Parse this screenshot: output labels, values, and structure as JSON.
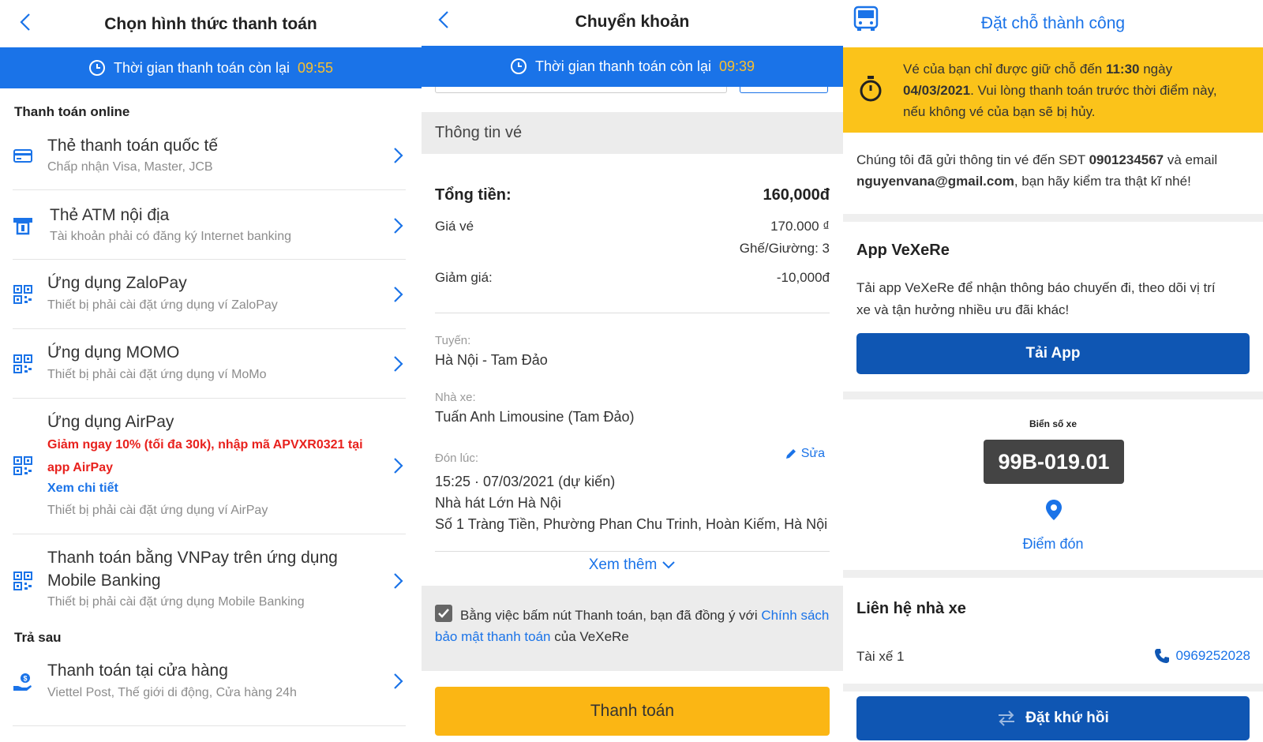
{
  "screen1": {
    "title": "Chọn hình thức thanh toán",
    "timer_label": "Thời gian thanh toán còn lại",
    "timer_value": "09:55",
    "online_heading": "Thanh toán online",
    "methods": [
      {
        "name": "Thẻ thanh toán quốc tế",
        "sub": "Chấp nhận Visa, Master, JCB",
        "icon": "credit-card-icon"
      },
      {
        "name": "Thẻ ATM nội địa",
        "sub": "Tài khoản phải có đăng ký Internet banking",
        "icon": "atm-icon"
      },
      {
        "name": "Ứng dụng ZaloPay",
        "sub": "Thiết bị phải cài đặt ứng dụng ví ZaloPay",
        "icon": "qr-icon"
      },
      {
        "name": "Ứng dụng MOMO",
        "sub": "Thiết bị phải cài đặt ứng dụng ví MoMo",
        "icon": "qr-icon"
      },
      {
        "name": "Ứng dụng AirPay",
        "promo": "Giảm ngay 10% (tối đa 30k), nhập mã APVXR0321 tại app AirPay",
        "detail": "Xem chi tiết",
        "sub": "Thiết bị phải cài đặt ứng dụng ví AirPay",
        "icon": "qr-icon"
      },
      {
        "name_line1": "Thanh toán bằng VNPay trên ứng dụng",
        "name_line2": "Mobile Banking",
        "sub": "Thiết bị phải cài đặt ứng dụng Mobile Banking",
        "icon": "qr-icon"
      }
    ],
    "later_heading": "Trả sau",
    "store": {
      "name": "Thanh toán tại cửa hàng",
      "sub": "Viettel Post, Thế giới di động, Cửa hàng 24h",
      "icon": "hand-coin-icon"
    }
  },
  "screen2": {
    "title": "Chuyển khoản",
    "timer_label": "Thời gian thanh toán còn lại",
    "timer_value": "09:39",
    "ticket_header": "Thông tin vé",
    "total_label": "Tổng tiền:",
    "total_value": "160,000đ",
    "price_label": "Giá vé",
    "price_value": "170.000 ₫",
    "seat_value": "Ghế/Giường: 3",
    "discount_label": "Giảm giá:",
    "discount_value": "-10,000đ",
    "route_label": "Tuyến:",
    "route_value": "Hà Nội - Tam Đảo",
    "operator_label": "Nhà xe:",
    "operator_value": "Tuấn Anh Limousine (Tam Đảo)",
    "pickup_label": "Đón lúc:",
    "edit_label": "Sửa",
    "pickup_time": "15:25 · 07/03/2021 (dự kiến)",
    "pickup_place": "Nhà hát Lớn Hà Nội",
    "pickup_address": "Số 1 Tràng Tiền, Phường Phan Chu Trinh, Hoàn Kiếm, Hà Nội",
    "more_label": "Xem thêm",
    "agree_text": "Bằng việc bấm nút Thanh toán, bạn đã đồng ý với ",
    "agree_link_1": "Chính",
    "agree_link_2": "sách bảo mật thanh toán",
    "agree_suffix": " của VeXeRe",
    "pay_button": "Thanh toán"
  },
  "screen3": {
    "title": "Đặt chỗ thành công",
    "warn_p1": "Vé của bạn chỉ được giữ chỗ đến ",
    "warn_time": "11:30",
    "warn_p2": " ngày",
    "warn_date": "04/03/2021",
    "warn_p3": ". Vui lòng thanh toán trước thời điểm này,",
    "warn_p4": "nếu không vé của bạn sẽ bị hủy.",
    "sent_p1": "Chúng tôi đã gửi thông tin vé đến SĐT ",
    "phone": "0901234567",
    "sent_p2": " và email",
    "email": "nguyenvana@gmail.com",
    "sent_p3": ", bạn hãy kiểm tra thật kĩ nhé!",
    "app_heading": "App VeXeRe",
    "app_text_1": "Tải app VeXeRe để nhận thông báo chuyến đi, theo dõi vị trí",
    "app_text_2": "xe và tận hưởng nhiều ưu đãi khác!",
    "app_button": "Tải App",
    "plate_label": "Biển số xe",
    "plate": "99B-019.01",
    "pickup_link": "Điểm đón",
    "contact_heading": "Liên hệ nhà xe",
    "driver_label": "Tài xế 1",
    "driver_phone": "0969252028",
    "return_button": "Đặt khứ hồi"
  },
  "colors": {
    "primary": "#1a73e8",
    "dark_blue": "#0f56b3",
    "yellow": "#fbc31a",
    "timer_value": "#fbc02d",
    "promo_red": "#e8211d"
  }
}
